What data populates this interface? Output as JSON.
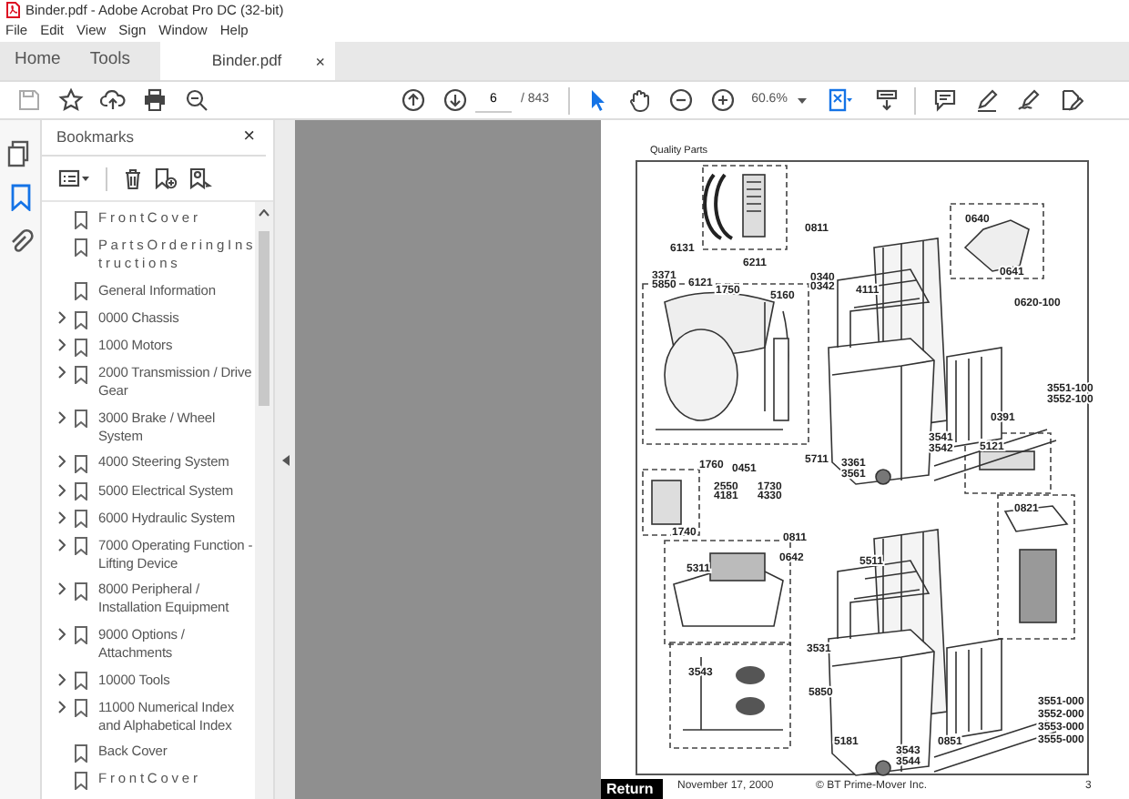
{
  "window": {
    "title": "Binder.pdf - Adobe Acrobat Pro DC (32-bit)"
  },
  "menu": [
    "File",
    "Edit",
    "View",
    "Sign",
    "Window",
    "Help"
  ],
  "tabs": [
    {
      "label": "Home",
      "selected": false
    },
    {
      "label": "Tools",
      "selected": false
    },
    {
      "label": "Binder.pdf",
      "selected": true,
      "close": "×"
    }
  ],
  "toolbar": {
    "page": "6",
    "page_count": "/ 843",
    "zoom": "60.6%",
    "tools": [
      {
        "kind": "select",
        "selected": true
      },
      {
        "kind": "hand",
        "selected": false
      }
    ]
  },
  "sidebar": {
    "tools": [
      {
        "kind": "pages",
        "selected": false
      },
      {
        "kind": "bookmarks",
        "selected": true
      },
      {
        "kind": "attachments",
        "selected": false
      }
    ]
  },
  "bookmarks": {
    "title": "Bookmarks",
    "close": "×",
    "items": [
      {
        "label": "F r o n t C o v e r",
        "expandable": false
      },
      {
        "label": "P a r t s O r d e r i n g I n s t r u c t i o n s",
        "expandable": false
      },
      {
        "label": "General Information",
        "expandable": false
      },
      {
        "label": "0000 Chassis",
        "expandable": true
      },
      {
        "label": "1000 Motors",
        "expandable": true
      },
      {
        "label": "2000 Transmission / Drive Gear",
        "expandable": true
      },
      {
        "label": "3000 Brake / Wheel System",
        "expandable": true
      },
      {
        "label": "4000 Steering System",
        "expandable": true
      },
      {
        "label": "5000 Electrical System",
        "expandable": true
      },
      {
        "label": "6000 Hydraulic System",
        "expandable": true
      },
      {
        "label": "7000 Operating Function - Lifting Device",
        "expandable": true
      },
      {
        "label": "8000 Peripheral / Installation Equipment",
        "expandable": true
      },
      {
        "label": "9000 Options / Attachments",
        "expandable": true
      },
      {
        "label": "10000 Tools",
        "expandable": true
      },
      {
        "label": "11000 Numerical Index and Alphabetical Index",
        "expandable": true
      },
      {
        "label": "Back Cover",
        "expandable": false
      },
      {
        "label": "F r o n t C o v e r",
        "expandable": false
      }
    ]
  },
  "document": {
    "header": "Quality Parts",
    "callouts": [
      "6131",
      "6211",
      "3371",
      "5850",
      "6121",
      "1750",
      "5160",
      "0811",
      "0340",
      "0342",
      "4111",
      "0640",
      "0641",
      "0620-100",
      "3551-100",
      "3552-100",
      "0391",
      "3541",
      "3542",
      "3361",
      "3561",
      "5121",
      "5711",
      "1760",
      "0451",
      "2550",
      "4181",
      "1730",
      "4330",
      "1740",
      "0821",
      "0811",
      "0642",
      "5311",
      "5511",
      "3531",
      "3543",
      "5850",
      "5181",
      "3543",
      "3544",
      "0851",
      "3551-000",
      "3552-000",
      "3553-000",
      "3555-000"
    ],
    "footer_date": "November 17, 2000",
    "copyright": "© BT Prime-Mover Inc.",
    "page_number": "3"
  },
  "return_button": "Return"
}
